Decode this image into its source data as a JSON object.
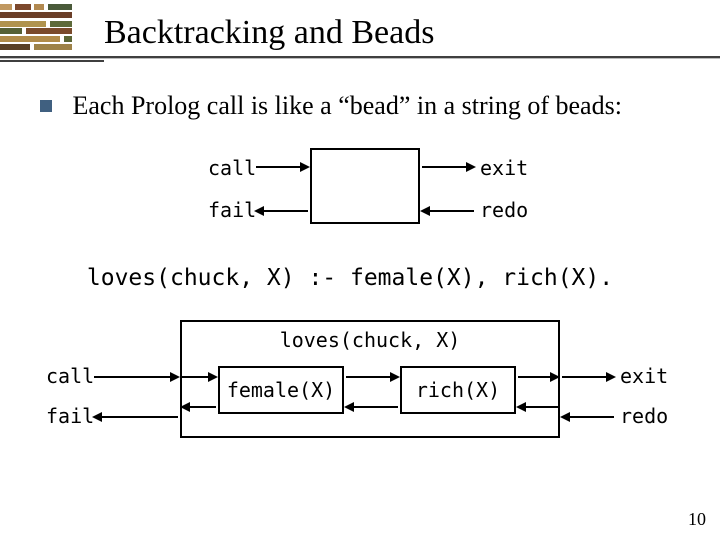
{
  "title": "Backtracking and Beads",
  "bullet": "Each Prolog call is like a “bead” in a string of beads:",
  "ports": {
    "call": "call",
    "fail": "fail",
    "exit": "exit",
    "redo": "redo"
  },
  "clause": "loves(chuck, X) :- female(X), rich(X).",
  "compound": {
    "head": "loves(chuck, X)",
    "goal1": "female(X)",
    "goal2": "rich(X)"
  },
  "slide_number": "10"
}
